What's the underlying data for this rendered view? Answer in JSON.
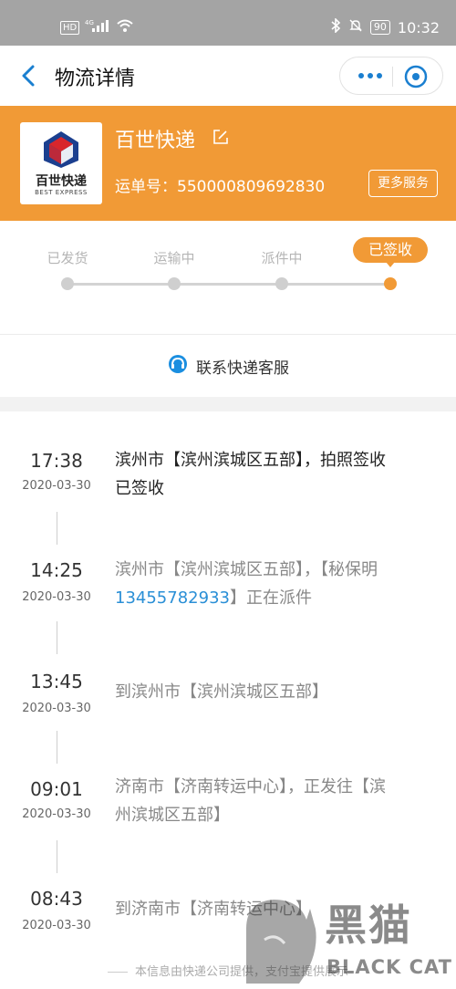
{
  "status_bar": {
    "left_icons": [
      "hd-icon",
      "signal-icon",
      "wifi-icon"
    ],
    "hd_text": "HD",
    "net_text": "4G",
    "battery": "90",
    "time": "10:32"
  },
  "header": {
    "title": "物流详情",
    "icons": [
      "back-arrow-icon",
      "more-dots-icon",
      "close-circle-icon"
    ]
  },
  "courier": {
    "name": "百世快递",
    "logo_cn": "百世快递",
    "logo_en": "BEST EXPRESS",
    "waybill": "运单号：550000809692830",
    "more_services": "更多服务",
    "accent_color": "#f19a36"
  },
  "progress": {
    "steps": [
      "已发货",
      "运输中",
      "派件中",
      "已签收"
    ],
    "current_step": 4
  },
  "contact": {
    "label": "联系快递客服",
    "icon": "headset-icon"
  },
  "timeline": [
    {
      "time": "17:38",
      "date": "2020-03-30",
      "desc_line1": "滨州市【滨州滨城区五部】，拍照签收",
      "desc_line2": "已签收"
    },
    {
      "time": "14:25",
      "date": "2020-03-30",
      "desc_line1": "滨州市【滨州滨城区五部】，【秘保明",
      "phone": "13455782933",
      "desc_line2_rest": "】正在派件"
    },
    {
      "time": "13:45",
      "date": "2020-03-30",
      "desc_line1": "到滨州市【滨州滨城区五部】"
    },
    {
      "time": "09:01",
      "date": "2020-03-30",
      "desc_line1": "济南市【济南转运中心】，正发往【滨",
      "desc_line2": "州滨城区五部】"
    },
    {
      "time": "08:43",
      "date": "2020-03-30",
      "desc_line1": "到济南市【济南转运中心】"
    }
  ],
  "footer": {
    "note": "本信息由快递公司提供，支付宝提供展示"
  },
  "watermark": {
    "cn": "黑猫",
    "en": "BLACK CAT"
  }
}
